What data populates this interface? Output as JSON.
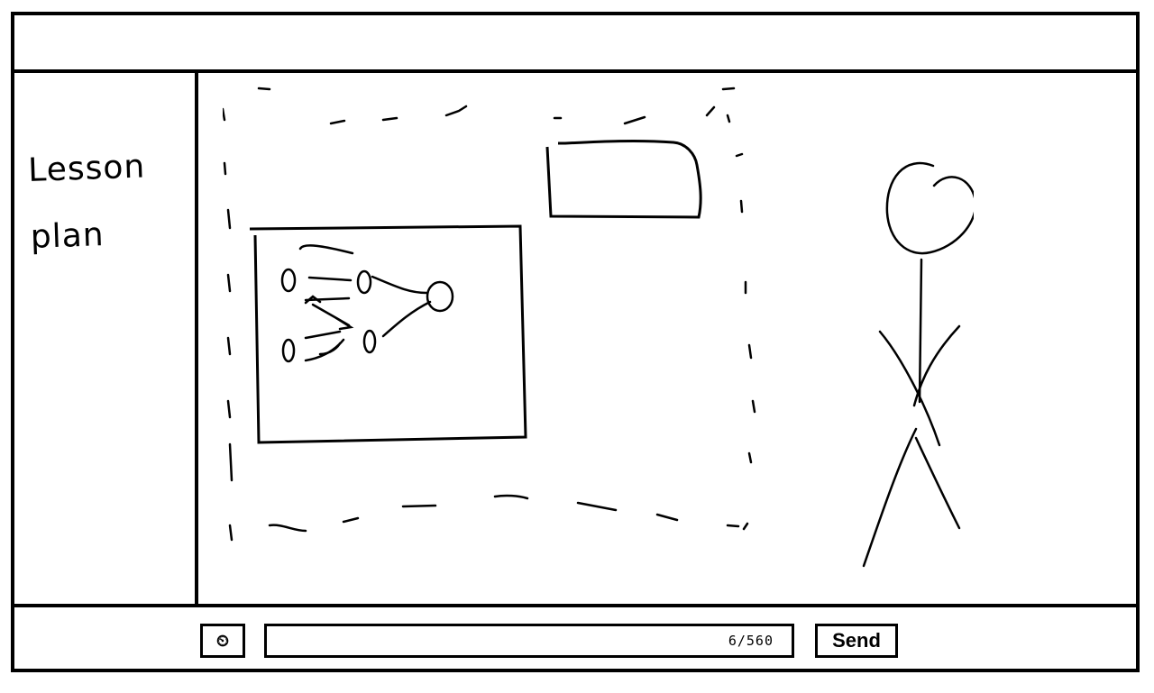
{
  "sidebar": {
    "title": "Lesson\nplan"
  },
  "toolbar": {
    "emoji_icon": "timer-icon",
    "emoji_glyph": "⏲",
    "message_placeholder": "",
    "char_counter": "6/560",
    "send_label": "Send"
  },
  "canvas": {
    "icons": [
      "slide-image-icon",
      "graph-diagram-icon",
      "text-box-icon",
      "teacher-figure-icon"
    ]
  }
}
